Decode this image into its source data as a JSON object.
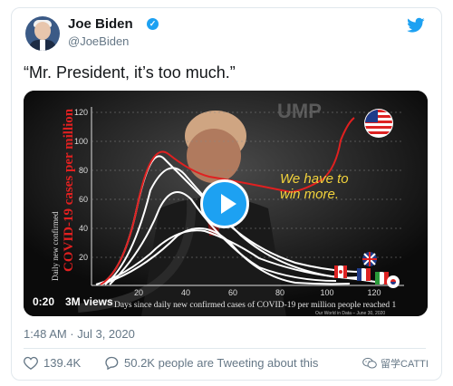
{
  "author": {
    "name": "Joe Biden",
    "handle": "@JoeBiden",
    "verified_icon": "verified-badge-icon"
  },
  "tweet": {
    "text": "“Mr. President, it’s too much.”",
    "timestamp": "1:48 AM · Jul 3, 2020",
    "likes": "139.4K",
    "tweeting": "50.2K people are Tweeting about this"
  },
  "video": {
    "time": "0:20",
    "views": "3M views",
    "overlay_text_line1": "We have to",
    "overlay_text_line2": "win more.",
    "chart_ylabel_main": "COVID-19 cases per million",
    "chart_ylabel_sub": "Daily new confirmed",
    "chart_xlabel": "Days since daily new confirmed cases of COVID-19 per million people reached 1",
    "chart_source": "Our World in Data – June 30, 2020",
    "background_text": "UMP",
    "y_ticks": [
      "120",
      "100",
      "80",
      "60",
      "40",
      "20"
    ],
    "x_ticks": [
      "20",
      "40",
      "60",
      "80",
      "100",
      "120"
    ]
  },
  "watermark": "留学CATTI",
  "colors": {
    "twitter_blue": "#1da1f2",
    "us_line": "#e02020",
    "overlay_text": "#f2d33c"
  }
}
